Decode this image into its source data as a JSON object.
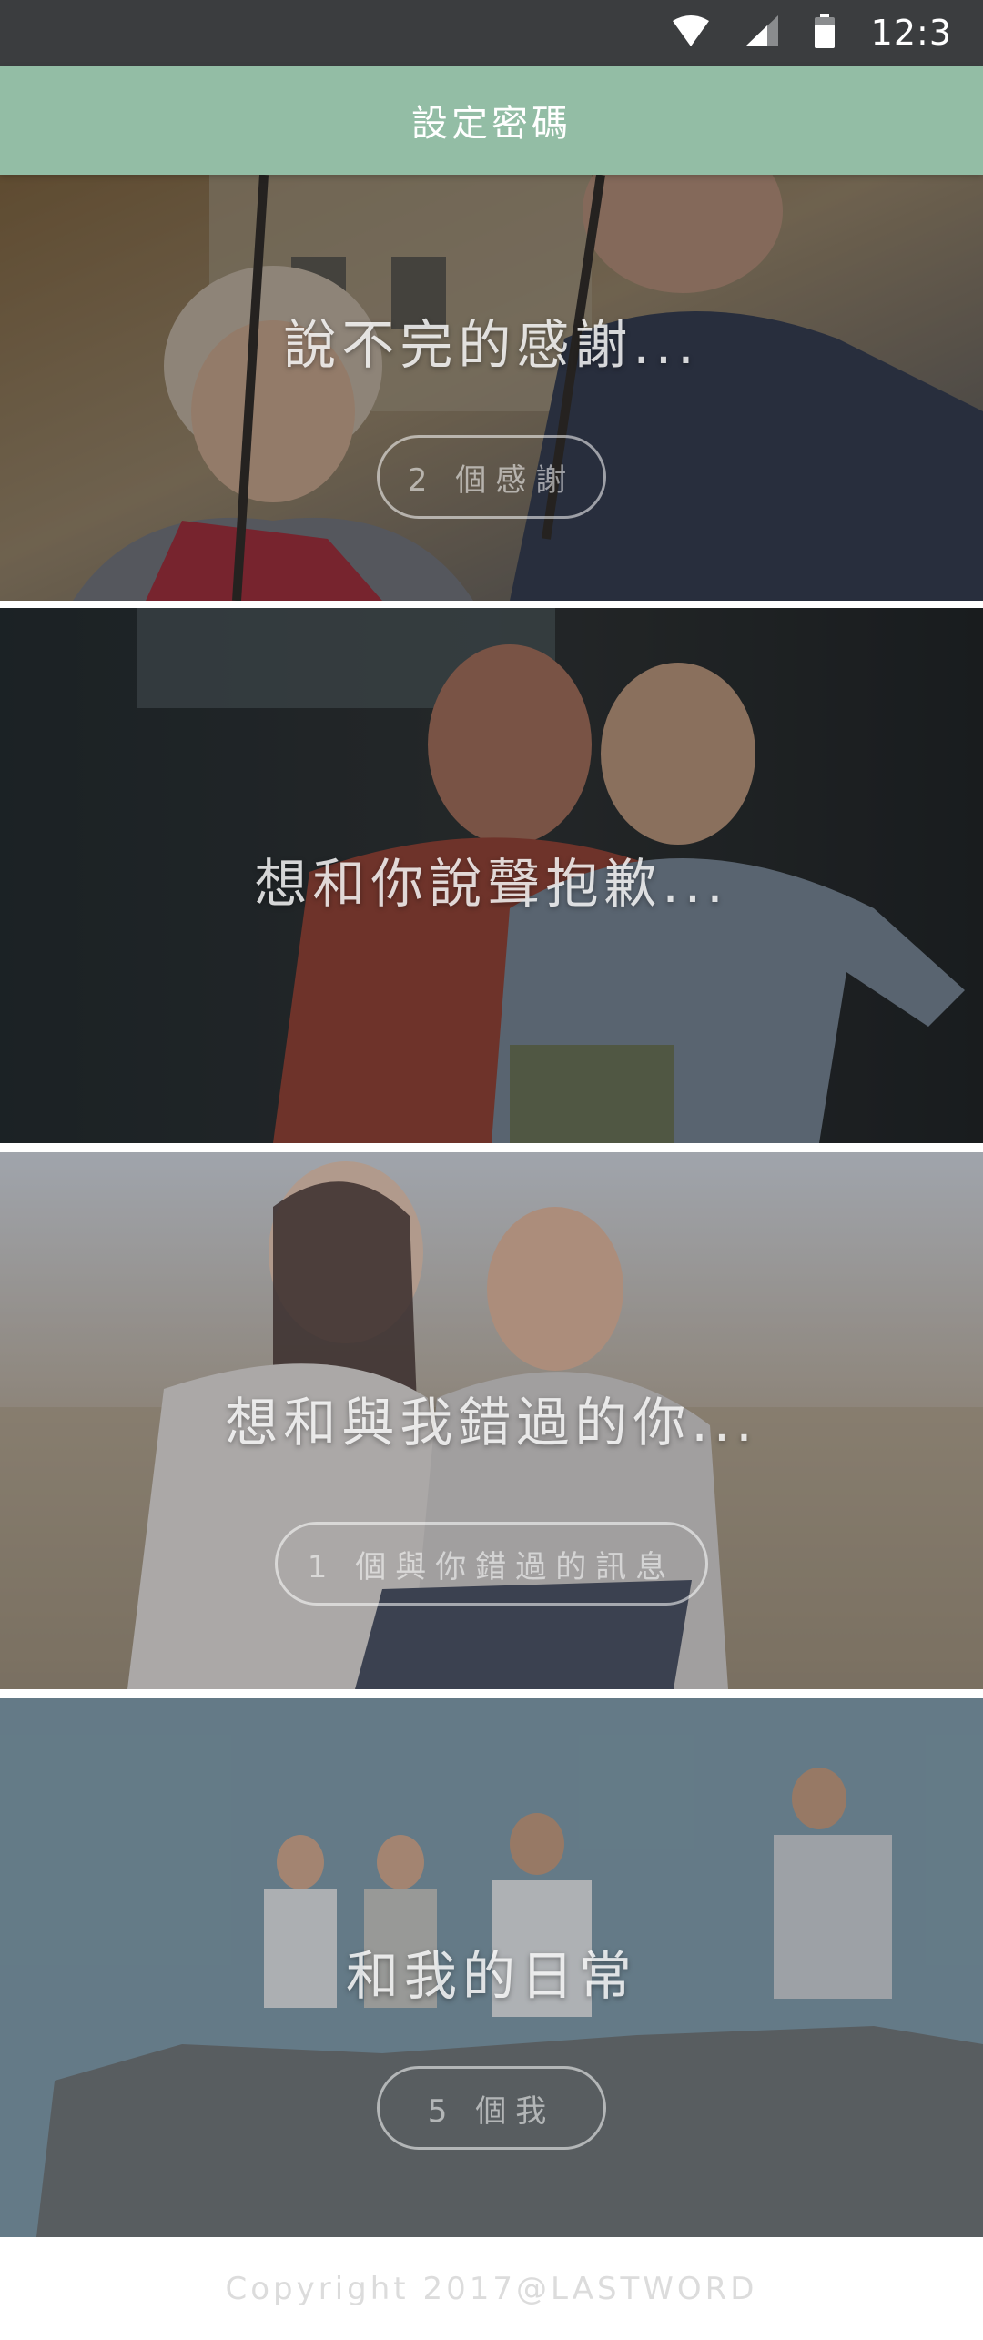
{
  "status_bar": {
    "time": "12:3",
    "icons": [
      "wifi-icon",
      "cellular-signal-icon",
      "battery-icon"
    ]
  },
  "app_bar": {
    "title": "設定密碼",
    "background": "#93bda5"
  },
  "cards": [
    {
      "title": "說不完的感謝...",
      "button": "2 個感謝"
    },
    {
      "title": "想和你說聲抱歉..."
    },
    {
      "title": "想和與我錯過的你...",
      "button": "1 個與你錯過的訊息"
    },
    {
      "title": "和我的日常",
      "button": "5 個我"
    }
  ],
  "footer": {
    "copyright": "Copyright 2017@LASTWORD"
  }
}
